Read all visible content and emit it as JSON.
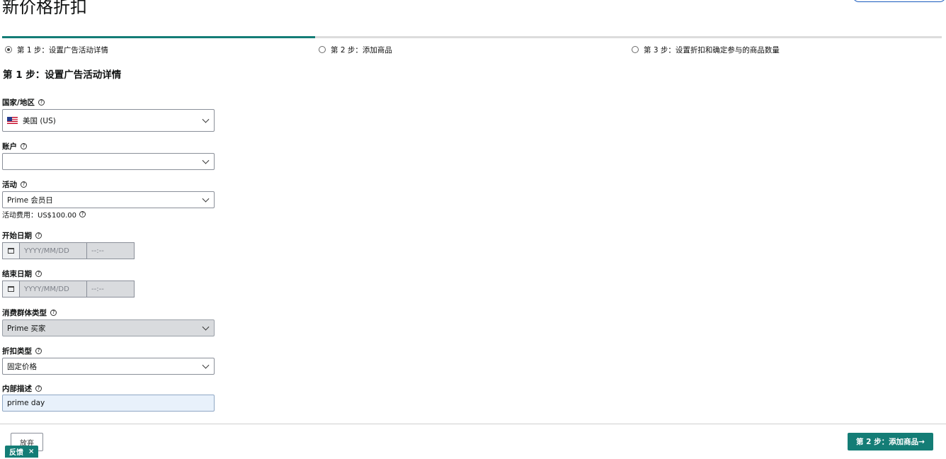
{
  "page": {
    "title": "新价格折扣"
  },
  "steps": [
    {
      "label": "第 1 步：设置广告活动详情",
      "active": true
    },
    {
      "label": "第 2 步：添加商品",
      "active": false
    },
    {
      "label": "第 3 步：设置折扣和确定参与的商品数量",
      "active": false
    }
  ],
  "form": {
    "section_title": "第 1 步：设置广告活动详情",
    "country": {
      "label": "国家/地区",
      "value": "美国 (US)",
      "icon": "us-flag-icon"
    },
    "account": {
      "label": "账户",
      "value": ""
    },
    "event": {
      "label": "活动",
      "value": "Prime 会员日",
      "fee_note": "活动费用：US$100.00"
    },
    "start_date": {
      "label": "开始日期",
      "date_placeholder": "YYYY/MM/DD",
      "time_placeholder": "--:--"
    },
    "end_date": {
      "label": "结束日期",
      "date_placeholder": "YYYY/MM/DD",
      "time_placeholder": "--:--"
    },
    "customer_segment": {
      "label": "消费群体类型",
      "value": "Prime 买家"
    },
    "discount_type": {
      "label": "折扣类型",
      "value": "固定价格"
    },
    "internal_description": {
      "label": "内部描述",
      "value": "prime day"
    }
  },
  "footer": {
    "cancel_label": "放弃",
    "next_label": "第 2 步：添加商品→",
    "feedback_label": "反馈",
    "feedback_close": "×"
  },
  "colors": {
    "accent": "#147d76",
    "progress_track": "#dcdcdc",
    "disabled_field": "#d9dbde"
  }
}
